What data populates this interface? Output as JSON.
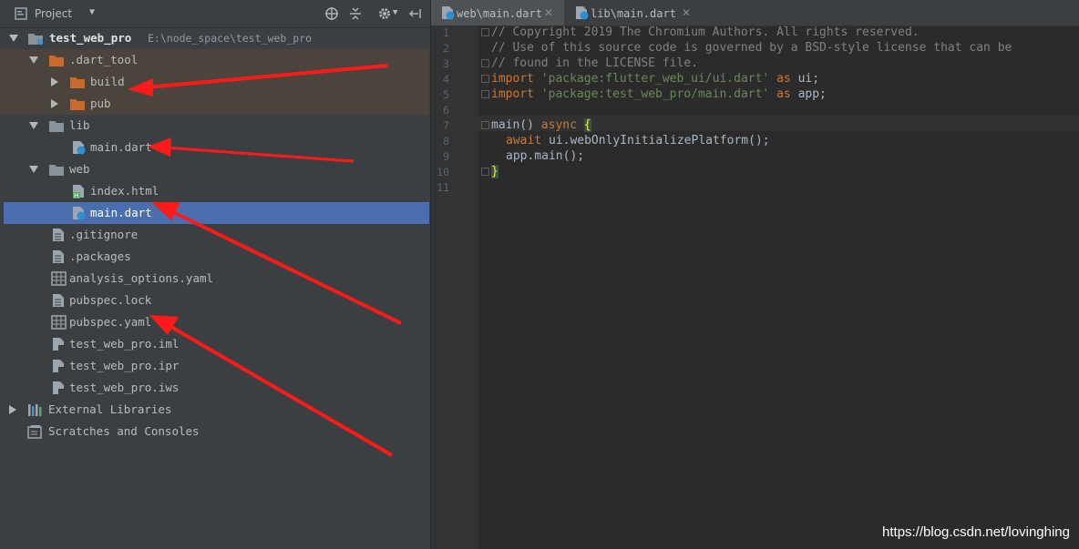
{
  "panel": {
    "title": "Project",
    "dropdown_icon": "chevron-down-icon",
    "header_icons": [
      "target-icon",
      "collapse-all-icon",
      "gear-icon",
      "hide-panel-icon"
    ]
  },
  "tree": {
    "root": {
      "label": "test_web_pro",
      "path": "E:\\node_space\\test_web_pro"
    },
    "dart_tool": ".dart_tool",
    "build": "build",
    "pub": "pub",
    "lib": "lib",
    "lib_main": "main.dart",
    "web": "web",
    "web_index": "index.html",
    "web_main": "main.dart",
    "gitignore": ".gitignore",
    "packages": ".packages",
    "analysis": "analysis_options.yaml",
    "pubspec_lock": "pubspec.lock",
    "pubspec_yaml": "pubspec.yaml",
    "iml": "test_web_pro.iml",
    "ipr": "test_web_pro.ipr",
    "iws": "test_web_pro.iws",
    "external": "External Libraries",
    "scratches": "Scratches and Consoles"
  },
  "tabs": [
    {
      "label": "web\\main.dart",
      "close": "✕"
    },
    {
      "label": "lib\\main.dart",
      "close": "✕"
    }
  ],
  "code": {
    "line_numbers": [
      "1",
      "2",
      "3",
      "4",
      "5",
      "6",
      "7",
      "8",
      "9",
      "10",
      "11"
    ],
    "l1": "// Copyright 2019 The Chromium Authors. All rights reserved.",
    "l2": "// Use of this source code is governed by a BSD-style license that can be",
    "l3": "// found in the LICENSE file.",
    "l4_kw": "import",
    "l4_str": "'package:flutter_web_ui/ui.dart'",
    "l4_as": "as",
    "l4_id": "ui;",
    "l5_kw": "import",
    "l5_str": "'package:test_web_pro/main.dart'",
    "l5_as": "as",
    "l5_id": "app;",
    "l7_fn": "main() ",
    "l7_async": "async",
    "l7_brace": "{",
    "l8_await": "await",
    "l8_rest": " ui.webOnlyInitializePlatform();",
    "l9": "app.main();",
    "l10_brace": "}"
  },
  "watermark": "https://blog.csdn.net/lovinghing",
  "colors": {
    "panel_bg": "#3c3f41",
    "editor_bg": "#2b2b2b",
    "selection": "#4b6eaf",
    "folder_orange": "#c9692b",
    "annotation_red": "#ff1a1a"
  }
}
